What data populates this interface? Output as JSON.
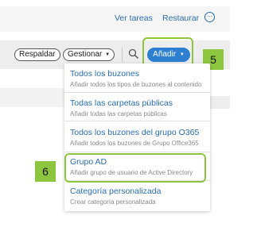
{
  "header": {
    "links": [
      "Ver tareas",
      "Restaurar"
    ],
    "more_icon": "ellipsis-circle-icon",
    "more_glyph": "···"
  },
  "toolbar": {
    "respaldar_label": "Respaldar",
    "gestionar_label": "Gestionar",
    "search_icon": "search-icon",
    "add_label": "Añadir",
    "caret_glyph": "▼"
  },
  "menu": {
    "items": [
      {
        "title": "Todos los buzones",
        "desc": "Añadir todos los tipos de buzones al contenido"
      },
      {
        "title": "Todas las carpetas públicas",
        "desc": "Añadir todas las carpetas públicas"
      },
      {
        "title": "Todos los buzones del grupo O365",
        "desc": "Añadir todos los buzones de Grupo Office365"
      },
      {
        "title": "Grupo AD",
        "desc": "Añadir grupo de usuario de Active Directory"
      },
      {
        "title": "Categoría personalizada",
        "desc": "Crear categoría personalizada"
      }
    ]
  },
  "annotations": {
    "step_add": "5",
    "step_group": "6",
    "highlight_color": "#8cc63f"
  },
  "colors": {
    "accent": "#2f7fd0",
    "link": "#2a6db3"
  }
}
